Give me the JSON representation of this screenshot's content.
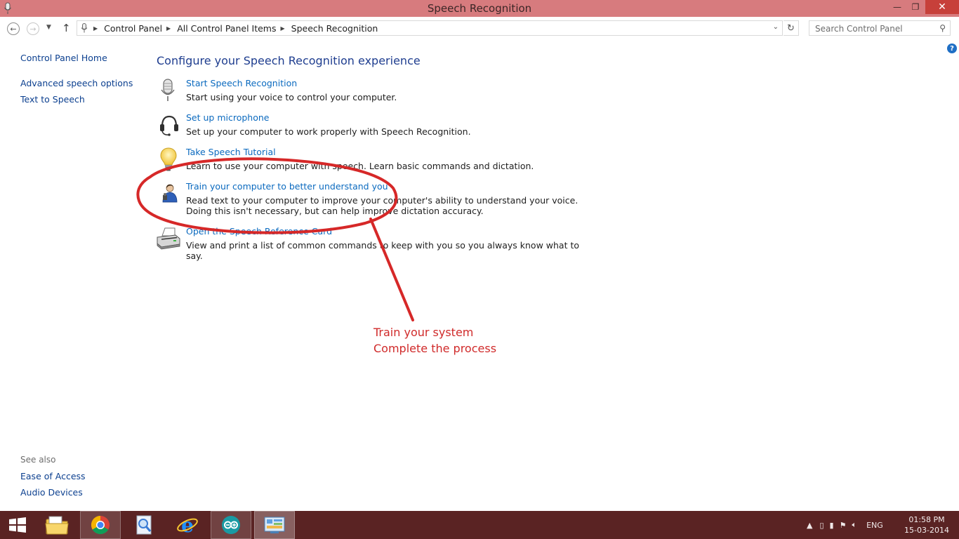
{
  "window": {
    "title": "Speech Recognition",
    "minimize_glyph": "—",
    "restore_glyph": "❐",
    "close_glyph": "✕"
  },
  "navigation": {
    "back_icon": "back-arrow-icon",
    "forward_icon": "forward-arrow-icon",
    "up_icon": "up-arrow-icon",
    "breadcrumbs": [
      "Control Panel",
      "All Control Panel Items",
      "Speech Recognition"
    ],
    "search_placeholder": "Search Control Panel"
  },
  "sidebar": {
    "links": [
      "Control Panel Home",
      "Advanced speech options",
      "Text to Speech"
    ],
    "see_also_label": "See also",
    "see_also_links": [
      "Ease of Access",
      "Audio Devices"
    ]
  },
  "main": {
    "heading": "Configure your Speech Recognition experience",
    "tasks": [
      {
        "icon": "microphone-icon",
        "link": "Start Speech Recognition",
        "desc": "Start using your voice to control your computer."
      },
      {
        "icon": "headset-icon",
        "link": "Set up microphone",
        "desc": "Set up your computer to work properly with Speech Recognition."
      },
      {
        "icon": "lightbulb-icon",
        "link": "Take Speech Tutorial",
        "desc": "Learn to use your computer with speech. Learn basic commands and dictation."
      },
      {
        "icon": "user-train-icon",
        "link": "Train your computer to better understand you",
        "desc": "Read text to your computer to improve your computer's ability to understand your voice.  Doing this isn't necessary, but can help improve dictation accuracy."
      },
      {
        "icon": "printer-icon",
        "link": "Open the Speech Reference Card",
        "desc": "View and print a list of common commands to keep with you so you always know what to say."
      }
    ]
  },
  "annotation": {
    "line1": "Train your system",
    "line2": "Complete the process",
    "color": "#d62828"
  },
  "taskbar": {
    "apps": [
      "file-explorer-icon",
      "chrome-icon",
      "search-app-icon",
      "internet-explorer-icon",
      "arduino-icon",
      "control-panel-icon"
    ],
    "language": "ENG",
    "time": "01:58 PM",
    "date": "15-03-2014"
  },
  "colors": {
    "titlebar": "#d77b7e",
    "taskbar": "#5a2323",
    "link": "#0b6abf",
    "heading": "#1e3d8f"
  }
}
